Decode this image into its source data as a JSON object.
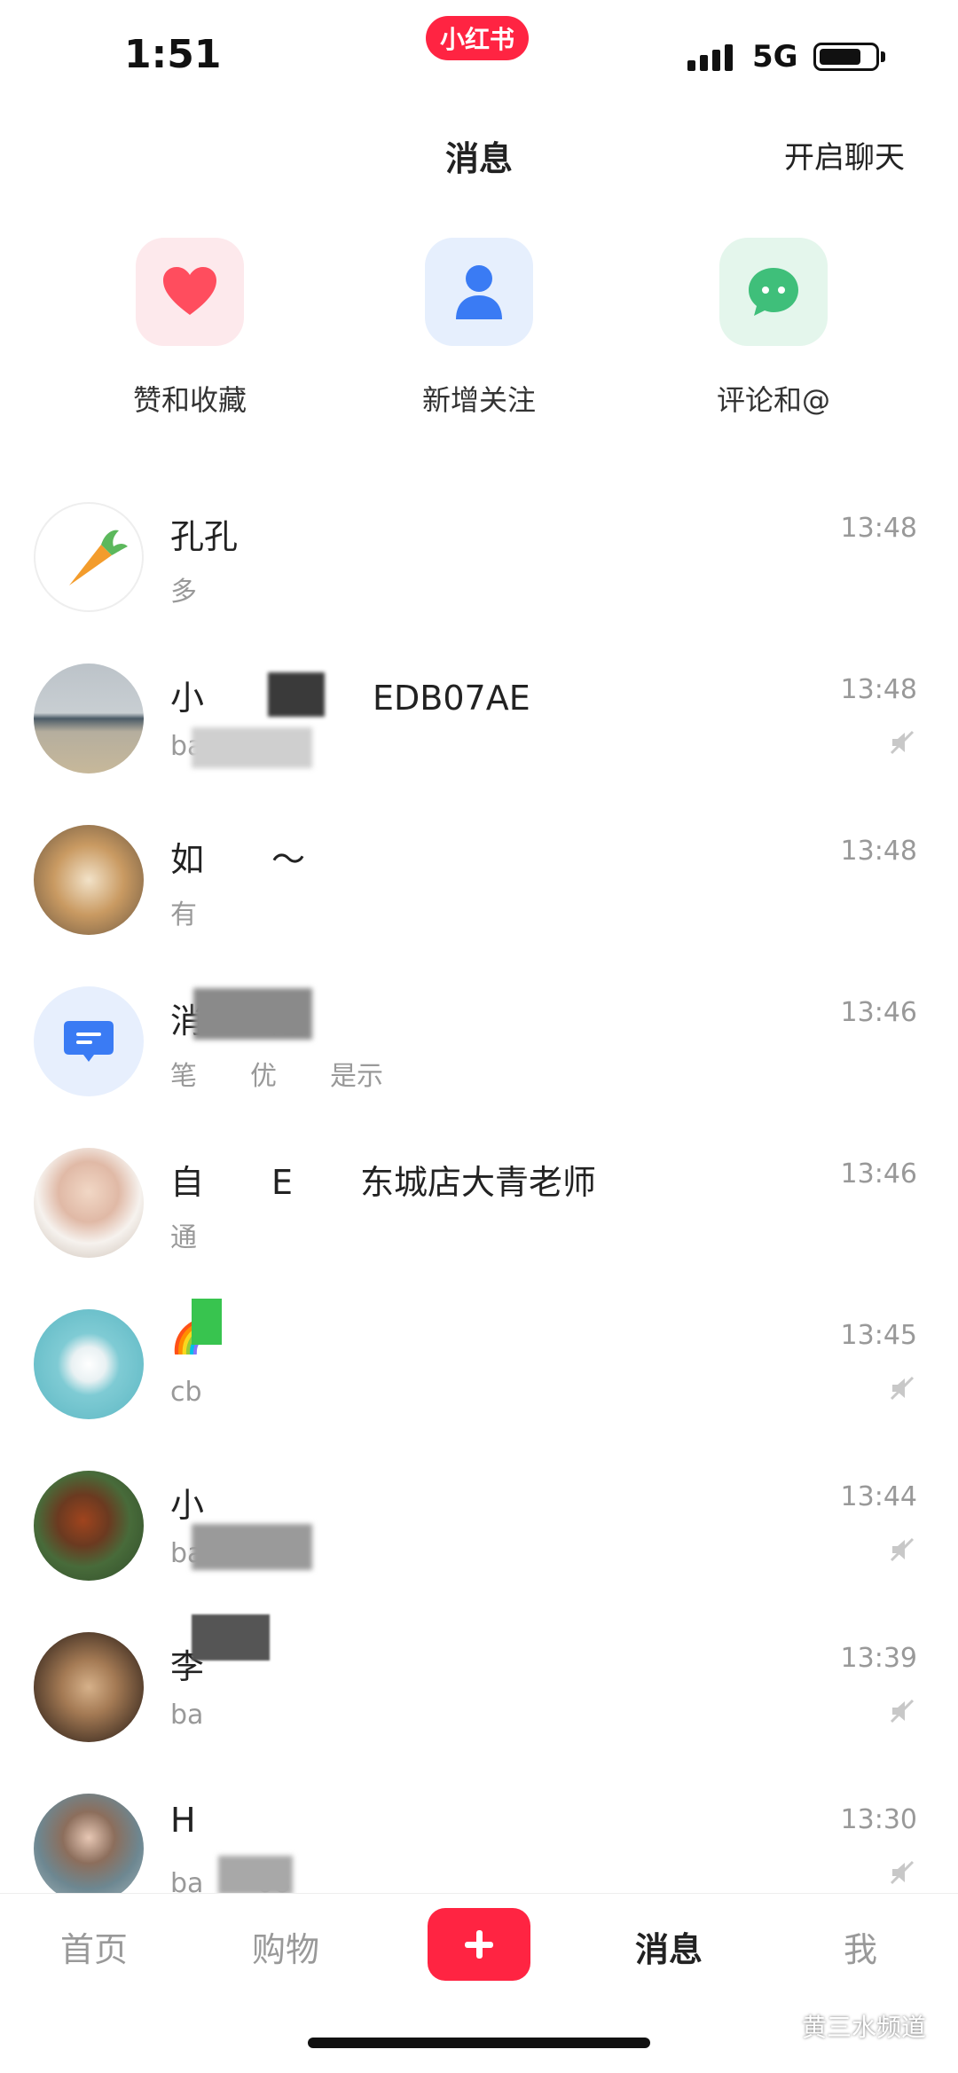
{
  "status_bar": {
    "time": "1:51",
    "app_badge": "小红书",
    "network": "5G"
  },
  "header": {
    "title": "消息",
    "action": "开启聊天"
  },
  "quick_actions": [
    {
      "label": "赞和收藏",
      "icon": "heart-icon",
      "color": "#ff4d5e",
      "bg": "#fde9ec"
    },
    {
      "label": "新增关注",
      "icon": "user-icon",
      "color": "#3a7bf4",
      "bg": "#e6effd"
    },
    {
      "label": "评论和@",
      "icon": "chat-icon",
      "color": "#3fbf7a",
      "bg": "#e4f6ec"
    }
  ],
  "messages": [
    {
      "name": "孔孔",
      "preview": "多",
      "time": "13:48",
      "muted": false
    },
    {
      "name": "小　　書　　EDB07AE",
      "preview": "ba",
      "time": "13:48",
      "muted": true
    },
    {
      "name": "如　　～",
      "preview": "有",
      "time": "13:48",
      "muted": false
    },
    {
      "name": "消　　通",
      "preview": "笔　　优　　是示",
      "time": "13:46",
      "muted": false
    },
    {
      "name": "自　　E　　东城店大青老师",
      "preview": "通",
      "time": "13:46",
      "muted": false
    },
    {
      "name": "🌈",
      "preview": "cb",
      "time": "13:45",
      "muted": true
    },
    {
      "name": "小",
      "preview": "ba",
      "time": "13:44",
      "muted": true
    },
    {
      "name": "李",
      "preview": "ba",
      "time": "13:39",
      "muted": true
    },
    {
      "name": "H",
      "preview": "ba　　08",
      "time": "13:30",
      "muted": true
    }
  ],
  "tabbar": {
    "home": "首页",
    "shop": "购物",
    "messages": "消息",
    "me": "我"
  },
  "watermark": "黄三水频道"
}
